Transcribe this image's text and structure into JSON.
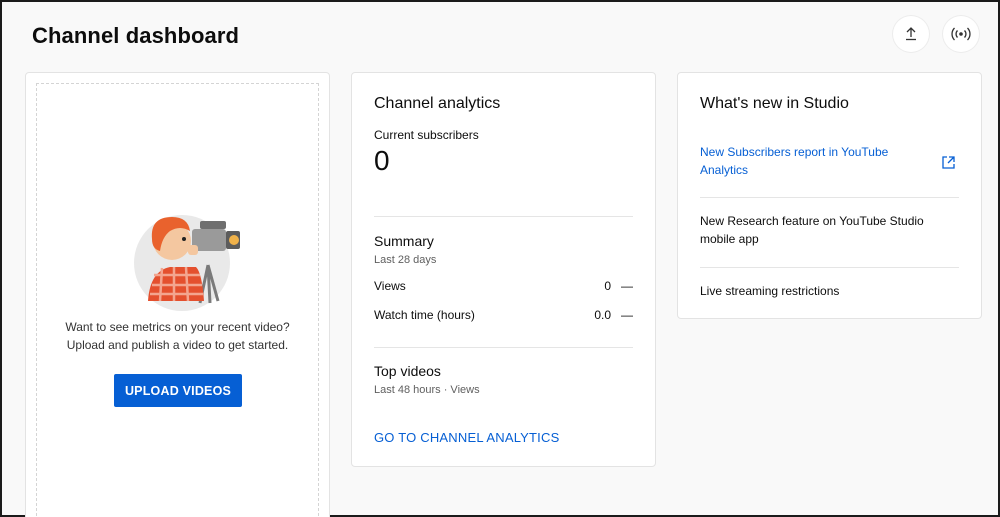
{
  "header": {
    "title": "Channel dashboard",
    "upload_icon": "upload-icon",
    "live_icon": "live-stream-icon"
  },
  "upload_card": {
    "prompt_line1": "Want to see metrics on your recent video?",
    "prompt_line2": "Upload and publish a video to get started.",
    "button_label": "UPLOAD VIDEOS",
    "accent": "#065fd4"
  },
  "analytics_card": {
    "title": "Channel analytics",
    "subscribers_label": "Current subscribers",
    "subscribers_value": "0",
    "summary_title": "Summary",
    "summary_period": "Last 28 days",
    "rows": [
      {
        "label": "Views",
        "value": "0",
        "trend": "—"
      },
      {
        "label": "Watch time (hours)",
        "value": "0.0",
        "trend": "—"
      }
    ],
    "top_videos_title": "Top videos",
    "top_videos_period": "Last 48 hours · Views",
    "cta_label": "GO TO CHANNEL ANALYTICS"
  },
  "news_card": {
    "title": "What's new in Studio",
    "items": [
      {
        "line1": "New Subscribers report in YouTube",
        "line2": "Analytics",
        "icon": "open-external-icon"
      },
      {
        "line1": "New Research feature on YouTube Studio",
        "line2": "mobile app"
      },
      {
        "line1": "Live streaming restrictions"
      }
    ]
  }
}
